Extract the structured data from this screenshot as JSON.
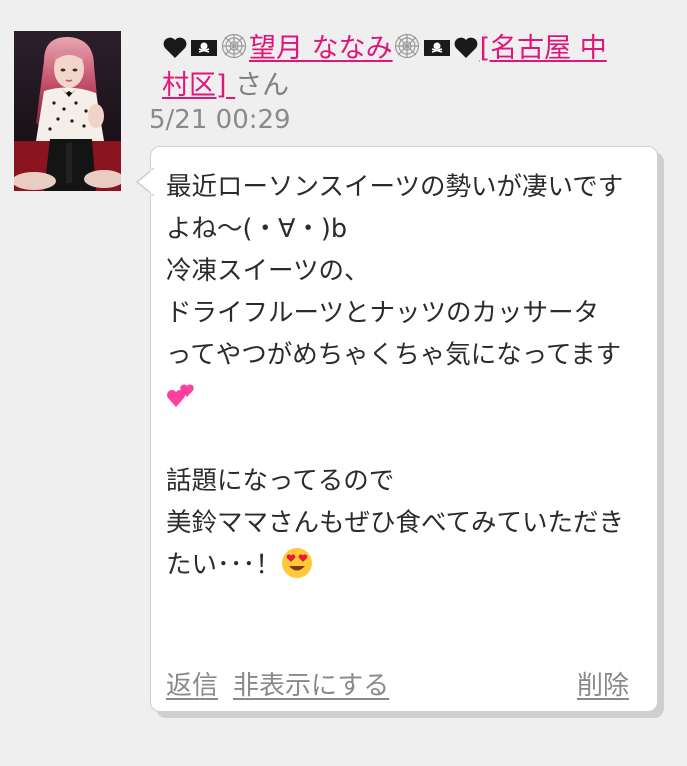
{
  "comment": {
    "user": {
      "name_prefix_icons": [
        "black-heart-icon",
        "pirate-flag-icon",
        "spiderweb-icon"
      ],
      "name_text": "望月 ななみ",
      "name_suffix_icons": [
        "spiderweb-icon",
        "pirate-flag-icon",
        "black-heart-icon"
      ],
      "area": "[名古屋 中村区]",
      "honorific": "さん"
    },
    "timestamp": "5/21 00:29",
    "body_lines": [
      "最近ローソンスイーツの勢いが凄いですよね〜(・∀・)b",
      "冷凍スイーツの、",
      "ドライフルーツとナッツのカッサータ",
      "ってやつがめちゃくちゃ気になってます"
    ],
    "body_line5_emoji": "two-hearts-icon",
    "body_lines_2": [
      "",
      "話題になってるので",
      "美鈴ママさんもぜひ食べてみていただきたい･･･！"
    ],
    "body_end_emoji": "heart-eyes-face-icon",
    "actions": {
      "reply": "返信",
      "hide": "非表示にする",
      "delete": "削除"
    }
  },
  "colors": {
    "background": "#efefef",
    "name_link": "#e0157a",
    "meta_text": "#8a8a8a",
    "bubble_bg": "#ffffff"
  }
}
